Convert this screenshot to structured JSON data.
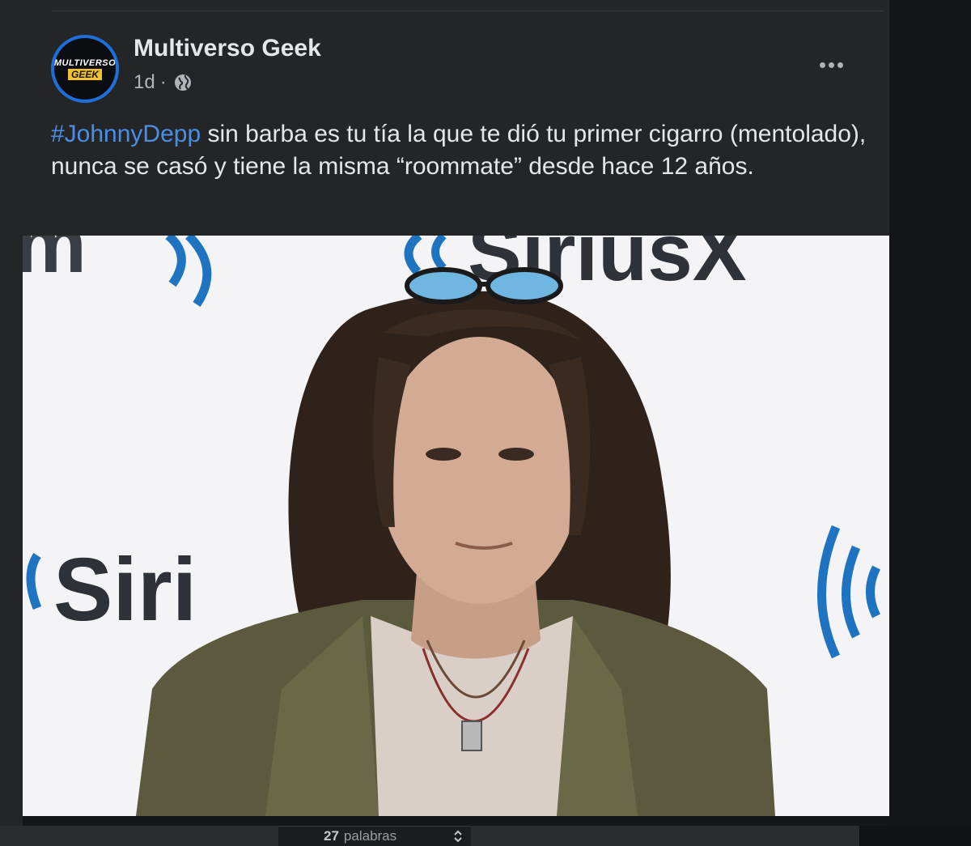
{
  "post": {
    "page_name": "Multiverso Geek",
    "time": "1d",
    "separator": "·",
    "privacy_icon": "globe-icon",
    "more_icon": "more-horizontal-icon",
    "avatar_text_top": "MULTIVERSO",
    "avatar_text_bottom": "GEEK",
    "hashtag": "#JohnnyDepp",
    "body": " sin barba es tu tía la que te dió tu primer cigarro (mentolado), nunca se casó y tiene la misma “roommate” desde hace 12 años.",
    "photo_signage": {
      "left": "Siri",
      "top": "SiriusX",
      "top_left": "m"
    }
  },
  "status_bar": {
    "word_count": "27",
    "word_label": "palabras",
    "stepper_icon": "stepper-icon"
  },
  "colors": {
    "card_bg": "#242526",
    "text": "#e4e6eb",
    "secondary_text": "#b0b3b8",
    "hashtag": "#4a8fe7",
    "sirius_blue": "#1f74c2"
  }
}
